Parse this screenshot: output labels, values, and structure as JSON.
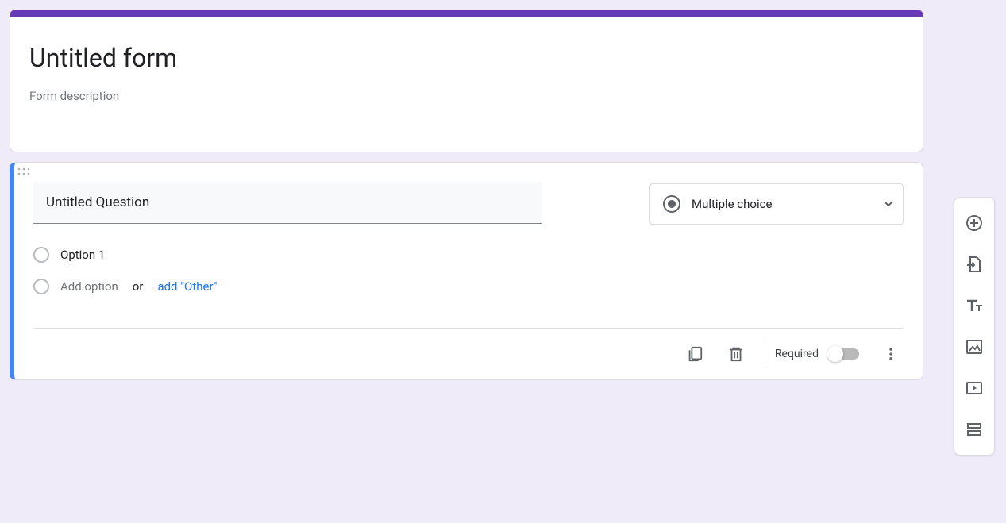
{
  "header": {
    "title": "Untitled form",
    "description_placeholder": "Form description"
  },
  "question": {
    "title": "Untitled Question",
    "type_label": "Multiple choice",
    "options": [
      {
        "label": "Option 1"
      }
    ],
    "add_option_placeholder": "Add option",
    "or_text": "or",
    "add_other_label": "add \"Other\"",
    "required_label": "Required"
  },
  "toolbar_icons": {
    "add_question": "add-circle-icon",
    "import_questions": "import-icon",
    "add_title": "text-icon",
    "add_image": "image-icon",
    "add_video": "video-icon",
    "add_section": "section-icon"
  }
}
